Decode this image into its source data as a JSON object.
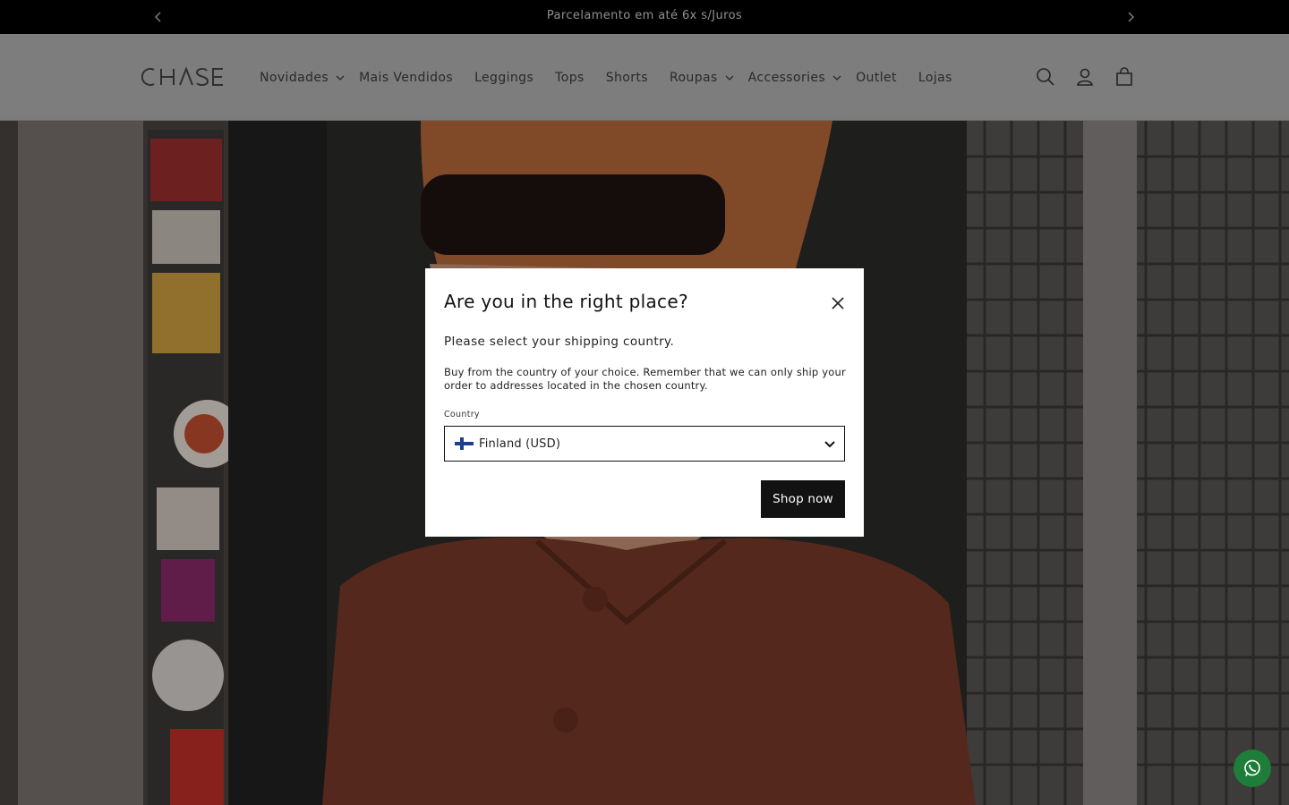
{
  "announcement": {
    "message": "Parcelamento em até 6x s/Juros",
    "prev_icon": "chevron-left-icon",
    "next_icon": "chevron-right-icon"
  },
  "header": {
    "logo_text": "CHASE",
    "nav": [
      {
        "label": "Novidades",
        "dropdown": true
      },
      {
        "label": "Mais Vendidos",
        "dropdown": false
      },
      {
        "label": "Leggings",
        "dropdown": false
      },
      {
        "label": "Tops",
        "dropdown": false
      },
      {
        "label": "Shorts",
        "dropdown": false
      },
      {
        "label": "Roupas",
        "dropdown": true
      },
      {
        "label": "Accessories",
        "dropdown": true
      },
      {
        "label": "Outlet",
        "dropdown": false
      },
      {
        "label": "Lojas",
        "dropdown": false
      }
    ],
    "icons": [
      "search-icon",
      "account-icon",
      "cart-icon"
    ]
  },
  "modal": {
    "title": "Are you in the right place?",
    "subtitle": "Please select your shipping country.",
    "description": "Buy from the country of your choice. Remember that we can only ship your order to addresses located in the chosen country.",
    "country_label": "Country",
    "country_value": "Finland (USD)",
    "shop_button": "Shop now"
  },
  "colors": {
    "header_bg": "#b3b3b3",
    "announcement_bg": "#000000",
    "button_bg": "#121212",
    "whatsapp": "#1f7d3a"
  }
}
